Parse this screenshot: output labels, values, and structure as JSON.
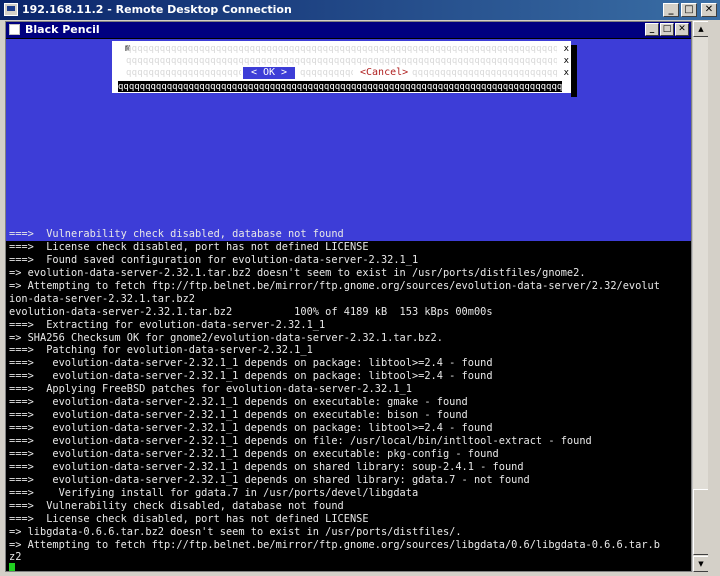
{
  "rdp": {
    "title": "192.168.11.2 - Remote Desktop Connection",
    "minimize": "_",
    "maximize": "□",
    "close": "✕"
  },
  "xwindow": {
    "title": "Black Pencil",
    "minimize": "_",
    "maximize": "□",
    "close": "✕"
  },
  "dialog": {
    "m_char": "m",
    "fill_text": "qqqqqqqqqqqqqqqqqqqqqqqqqqqqqqqqqqqqqqqqqqqqqqqqqqqqqqqqqqqqqqqqqqqqqqqqqqqqqqqqqqqqqqqqqqqqqqqqqqqqq",
    "ok_label": "< OK >",
    "cancel_label": "<Cancel>",
    "bottom_text": "qqqqqqqqqqqqqqqqqqqqqqqqqqqqqqqqqqqqqqqqqqqqqqqqqqqqqqqqqqqqqqqqqqqqqqqqqqqqqqqqqqqqqqqqqqqqqqqqqqqqqqqqqqqqqqj",
    "xmark": "x"
  },
  "terminal": {
    "lines": [
      "===>  Vulnerability check disabled, database not found",
      "===>  License check disabled, port has not defined LICENSE",
      "===>  Found saved configuration for evolution-data-server-2.32.1_1",
      "=> evolution-data-server-2.32.1.tar.bz2 doesn't seem to exist in /usr/ports/distfiles/gnome2.",
      "=> Attempting to fetch ftp://ftp.belnet.be/mirror/ftp.gnome.org/sources/evolution-data-server/2.32/evolut",
      "ion-data-server-2.32.1.tar.bz2",
      "evolution-data-server-2.32.1.tar.bz2          100% of 4189 kB  153 kBps 00m00s",
      "===>  Extracting for evolution-data-server-2.32.1_1",
      "=> SHA256 Checksum OK for gnome2/evolution-data-server-2.32.1.tar.bz2.",
      "===>  Patching for evolution-data-server-2.32.1_1",
      "===>   evolution-data-server-2.32.1_1 depends on package: libtool>=2.4 - found",
      "===>   evolution-data-server-2.32.1_1 depends on package: libtool>=2.4 - found",
      "===>  Applying FreeBSD patches for evolution-data-server-2.32.1_1",
      "===>   evolution-data-server-2.32.1_1 depends on executable: gmake - found",
      "===>   evolution-data-server-2.32.1_1 depends on executable: bison - found",
      "===>   evolution-data-server-2.32.1_1 depends on package: libtool>=2.4 - found",
      "===>   evolution-data-server-2.32.1_1 depends on file: /usr/local/bin/intltool-extract - found",
      "===>   evolution-data-server-2.32.1_1 depends on executable: pkg-config - found",
      "===>   evolution-data-server-2.32.1_1 depends on shared library: soup-2.4.1 - found",
      "===>   evolution-data-server-2.32.1_1 depends on shared library: gdata.7 - not found",
      "===>    Verifying install for gdata.7 in /usr/ports/devel/libgdata",
      "===>  Vulnerability check disabled, database not found",
      "===>  License check disabled, port has not defined LICENSE",
      "=> libgdata-0.6.6.tar.bz2 doesn't seem to exist in /usr/ports/distfiles/.",
      "=> Attempting to fetch ftp://ftp.belnet.be/mirror/ftp.gnome.org/sources/libgdata/0.6/libgdata-0.6.6.tar.b",
      "z2"
    ]
  },
  "scrollbar": {
    "up_arrow": "▲",
    "down_arrow": "▼"
  },
  "colors": {
    "terminal_bg": "#000000",
    "dialog_blue": "#3d3dd7",
    "cursor": "#20d020"
  }
}
